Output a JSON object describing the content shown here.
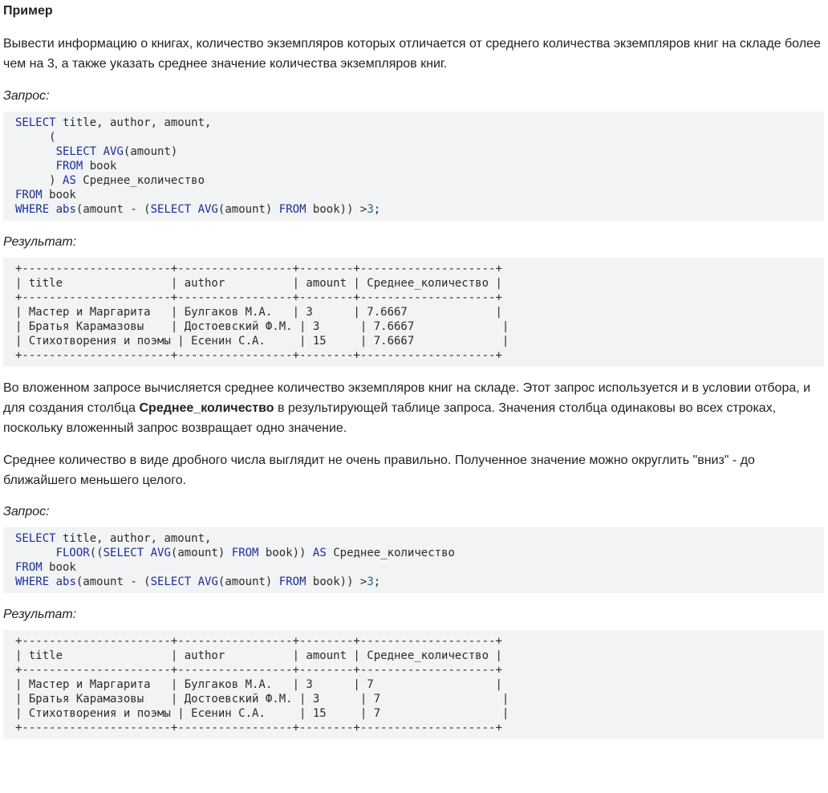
{
  "heading": "Пример",
  "intro": "Вывести информацию о книгах, количество экземпляров которых отличается от среднего количества экземпляров книг на складе более чем на 3,  а также указать среднее значение количества экземпляров книг.",
  "label_query": "Запрос:",
  "label_result": "Результат:",
  "query1": "SELECT title, author, amount,\n     (\n      SELECT AVG(amount)\n      FROM book\n     ) AS Среднее_количество\nFROM book\nWHERE abs(amount - (SELECT AVG(amount) FROM book)) >3;",
  "result1": "+----------------------+-----------------+--------+--------------------+\n| title                | author          | amount | Среднее_количество |\n+----------------------+-----------------+--------+--------------------+\n| Мастер и Маргарита   | Булгаков М.А.   | 3      | 7.6667             |\n| Братья Карамазовы    | Достоевский Ф.М. | 3      | 7.6667             |\n| Стихотворения и поэмы | Есенин С.А.     | 15     | 7.6667             |\n+----------------------+-----------------+--------+--------------------+",
  "para2_before": "Во вложенном запросе вычисляется среднее количество экземпляров книг на складе. Этот запрос используется и в условии отбора, и для создания столбца ",
  "para2_bold": "Среднее_количество",
  "para2_after": " в результирующей таблице запроса. Значения  столбца одинаковы во всех строках, поскольку  вложенный запрос возвращает одно значение.",
  "para3": "Среднее количество в виде дробного числа выглядит не очень правильно. Полученное значение можно округлить \"вниз\" - до ближайшего меньшего целого.",
  "query2": "SELECT title, author, amount,\n      FLOOR((SELECT AVG(amount) FROM book)) AS Среднее_количество\nFROM book\nWHERE abs(amount - (SELECT AVG(amount) FROM book)) >3;",
  "result2": "+----------------------+-----------------+--------+--------------------+\n| title                | author          | amount | Среднее_количество |\n+----------------------+-----------------+--------+--------------------+\n| Мастер и Маргарита   | Булгаков М.А.   | 3      | 7                  |\n| Братья Карамазовы    | Достоевский Ф.М. | 3      | 7                  |\n| Стихотворения и поэмы | Есенин С.А.     | 15     | 7                  |\n+----------------------+-----------------+--------+--------------------+",
  "colors": {
    "code_background": "#f2f3f4",
    "keyword": "#1a2f99",
    "text": "#222222"
  }
}
